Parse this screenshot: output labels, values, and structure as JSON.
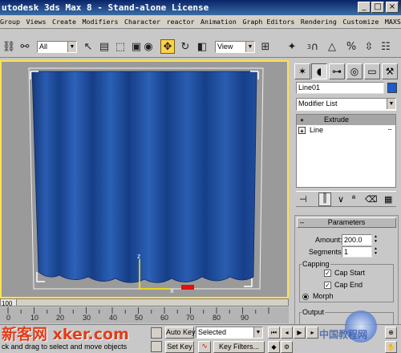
{
  "window": {
    "title": "utodesk 3ds Max 8  - Stand-alone License",
    "min_glyph": "_",
    "max_glyph": "□",
    "close_glyph": "×"
  },
  "menu": [
    "Group",
    "Views",
    "Create",
    "Modifiers",
    "Character",
    "reactor",
    "Animation",
    "Graph Editors",
    "Rendering",
    "Customize",
    "MAXScript"
  ],
  "toolbar": {
    "selection_filter": "All",
    "coord_system": "View",
    "snap_value": "3"
  },
  "viewport": {
    "curtain_color": "#1e4d9e",
    "border_color": "#ffe24a"
  },
  "command_panel": {
    "object_name": "Line01",
    "object_color": "#1c5bd0",
    "modifier_list_label": "Modifier List",
    "stack": [
      {
        "label": "Extrude",
        "selected": true
      },
      {
        "label": "Line",
        "selected": false
      }
    ],
    "rollout_title": "Parameters",
    "amount_label": "Amount:",
    "amount_value": "200.0",
    "segments_label": "Segments:",
    "segments_value": "1",
    "capping_label": "Capping",
    "cap_start_label": "Cap Start",
    "cap_start_checked": true,
    "cap_end_label": "Cap End",
    "cap_end_checked": true,
    "morph_label": "Morph",
    "output_label": "Output"
  },
  "timeline": {
    "frame_display": "100",
    "ticks": [
      "0",
      "10",
      "20",
      "30",
      "40",
      "50",
      "60",
      "70",
      "80",
      "90"
    ]
  },
  "status": {
    "prompt": "ck and drag to select and move objects",
    "auto_key_label": "Auto Key",
    "selected_label": "Selected",
    "set_key_label": "Set Key",
    "key_filters_label": "Key Filters..."
  },
  "watermark": {
    "left_text": "新客网 xker.com",
    "right_text": "中国教程网"
  }
}
